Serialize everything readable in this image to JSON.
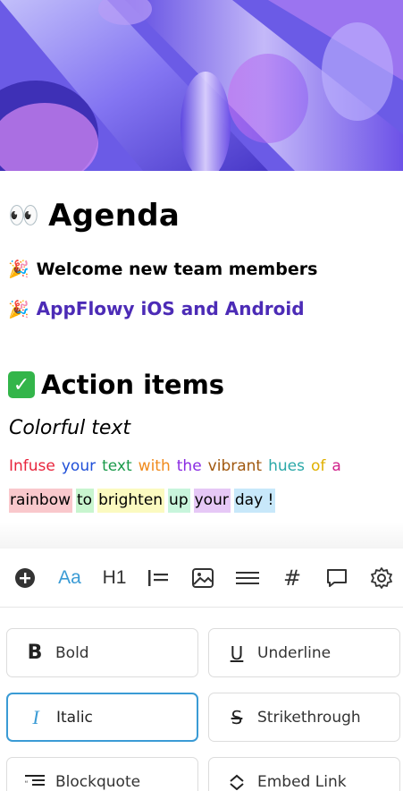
{
  "cover": {
    "description_icon": "abstract-gradient-cover"
  },
  "document": {
    "title_emoji": "👀",
    "title": "Agenda",
    "item1_emoji": "🎉",
    "item1": "Welcome new team members",
    "item2_emoji": "🎉",
    "item2": "AppFlowy iOS and Android",
    "section_icon": "check-mark-icon",
    "section_title": "Action items",
    "italic_text": "Colorful text",
    "rainbow_line1": [
      {
        "text": "Infuse",
        "color": "#e8243c"
      },
      {
        "text": "your",
        "color": "#1f4fd8"
      },
      {
        "text": "text",
        "color": "#1a9a4a"
      },
      {
        "text": "with",
        "color": "#f08a1c"
      },
      {
        "text": "the",
        "color": "#8a2be2"
      },
      {
        "text": "vibrant",
        "color": "#a0580f"
      },
      {
        "text": "hues",
        "color": "#2aa8a8"
      },
      {
        "text": "of",
        "color": "#e0b000"
      },
      {
        "text": "a",
        "color": "#d0208a"
      }
    ],
    "rainbow_line2": [
      {
        "text": "rainbow",
        "bg": "#f9c8cc"
      },
      {
        "text": "to",
        "bg": "#c8f5cf"
      },
      {
        "text": "brighten",
        "bg": "#fbfac0"
      },
      {
        "text": "up",
        "bg": "#c8f5dc"
      },
      {
        "text": "your",
        "bg": "#e6c8f6"
      },
      {
        "text": "day !",
        "bg": "#c8e8fa"
      }
    ]
  },
  "toolbar": {
    "items": [
      "add-icon",
      "text-format-icon",
      "heading-icon",
      "list-icon",
      "image-icon",
      "divider-icon",
      "hashtag-icon",
      "comment-icon",
      "settings-icon"
    ],
    "text_format_label": "Aa",
    "heading_label": "H1",
    "accent": "#3a9bd5"
  },
  "format": {
    "bold": "Bold",
    "underline": "Underline",
    "italic": "Italic",
    "strikethrough": "Strikethrough",
    "blockquote": "Blockquote",
    "embed_link": "Embed Link"
  }
}
